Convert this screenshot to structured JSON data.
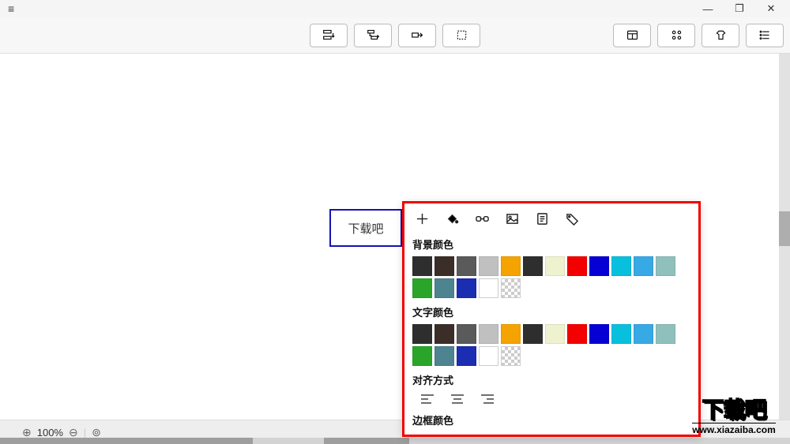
{
  "node_text": "下载吧",
  "zoom_label": "100%",
  "popover": {
    "sections": {
      "bg": "背景颜色",
      "text": "文字颜色",
      "align": "对齐方式",
      "border": "边框颜色"
    },
    "swatches": [
      {
        "hex": "#2e2e2e"
      },
      {
        "hex": "#3b2e28"
      },
      {
        "hex": "#5a5a5a"
      },
      {
        "hex": "#c0c0c0"
      },
      {
        "hex": "#f5a300"
      },
      {
        "hex": "#2e2e2e"
      },
      {
        "hex": "#eff2cf"
      },
      {
        "hex": "#f30000"
      },
      {
        "hex": "#0600d4"
      },
      {
        "hex": "#08c0de"
      },
      {
        "hex": "#37a9e4"
      },
      {
        "hex": "#90c0bb"
      },
      {
        "hex": "#2aa52a"
      },
      {
        "hex": "#4e8390"
      },
      {
        "hex": "#1b2db0"
      },
      {
        "hex": "#ffffff"
      },
      {
        "hex": "transparent"
      }
    ]
  },
  "watermark": {
    "main": "下载吧",
    "url": "www.xiazaiba.com"
  }
}
